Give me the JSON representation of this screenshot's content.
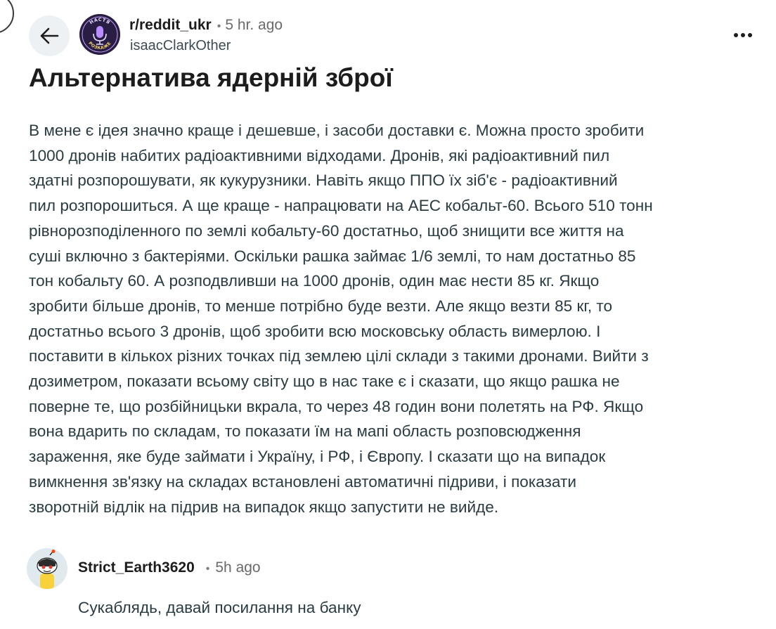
{
  "header": {
    "subreddit": "r/reddit_ukr",
    "separator": "•",
    "time": "5 hr. ago",
    "username": "isaacClarkOther",
    "subreddit_avatar_text_top": "НАСТЯ",
    "subreddit_avatar_text_bottom": "РОЗКАЖЕ"
  },
  "post": {
    "title": "Альтернатива ядерній зброї",
    "body_lines": [
      "В мене є ідея значно краще і дешевше, і засоби доставки є. Можна просто зробити",
      "1000 дронів набитих радіоактивними відходами. Дронів, які радіоактивний пил",
      "здатні розпорошувати, як кукурузники. Навіть якщо ППО їх зіб'є - радіоактивний",
      "пил розпорошиться. А ще краще - напрацювати на АЕС кобальт-60. Всього 510 тонн",
      "рівнорозподіленного по землі кобальту-60 достатньо, щоб знищити все життя на",
      "суші включно з бактеріями. Оскільки рашка займає 1/6 землі, то нам достатньо 85",
      "тон кобальту 60. А розподвливши на 1000 дронів, один має нести 85 кг. Якщо",
      "зробити більше дронів, то менше потрібно буде везти. Але якщо везти 85 кг, то",
      "достатньо всього 3 дронів, щоб зробити всю московську область вимерлою. І",
      "поставити в кількох різних точках під землею цілі склади з такими дронами. Вийти з",
      "дозиметром, показати всьому світу що в нас таке є і сказати, що якщо рашка не",
      "поверне те, що розбійницьки вкрала, то через 48 годин вони полетять на РФ. Якщо",
      "вона вдарить по складам, то показати їм на мапі область розповсюдження",
      "зараження, яке буде займати і Україну, і РФ, і Європу. І сказати що на випадок",
      "вимкнення зв'язку на складах встановлені автоматичні підриви, і показати",
      "зворотній відлік на підрив на випадок якщо запустити не вийде."
    ]
  },
  "comment": {
    "author": "Strict_Earth3620",
    "separator": "•",
    "time": "5h ago",
    "text": "Сукаблядь, давай посилання на банку"
  },
  "icons": {
    "back": "arrow-left-icon",
    "more": "more-horizontal-icon"
  },
  "colors": {
    "background": "#ffffff",
    "title": "#1c1c1c",
    "body_text": "#2a3c42",
    "meta_text": "#6a6a6a",
    "back_button_bg": "#eef1f3"
  }
}
